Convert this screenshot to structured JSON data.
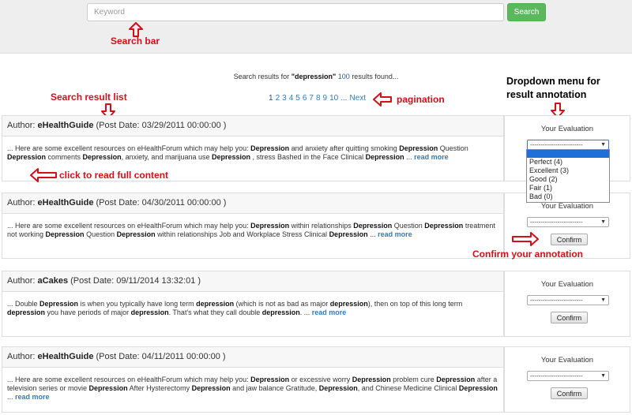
{
  "search": {
    "placeholder": "Keyword",
    "button_label": "Search"
  },
  "annotations": {
    "search_bar": "Search bar",
    "result_list": "Search result list",
    "pagination": "pagination",
    "dropdown_line1": "Dropdown menu for",
    "dropdown_line2": "result annotation",
    "read_full": "click to read full content",
    "confirm_annotation": "Confirm your annotation"
  },
  "summary": {
    "prefix": "Search results for",
    "query": "\"depression\"",
    "count": "100",
    "suffix": "results found..."
  },
  "pagination": {
    "pages": [
      "1",
      "2",
      "3",
      "4",
      "5",
      "6",
      "7",
      "8",
      "9",
      "10"
    ],
    "ellipsis": "...",
    "next": "Next"
  },
  "evaluation": {
    "title": "Your Evaluation",
    "placeholder": "-------------------------",
    "confirm_label": "Confirm",
    "options": [
      "Perfect (4)",
      "Excellent (3)",
      "Good (2)",
      "Fair (1)",
      "Bad (0)"
    ]
  },
  "results": [
    {
      "author_label": "Author:",
      "author": "eHealthGuide",
      "post_date": "(Post Date: 03/29/2011 00:00:00 )",
      "body_html": "... Here are some excellent resources on eHealthForum which may help you: <b>Depression</b> and anxiety after quitting smoking <b>Depression</b> Question <b>Depression</b> comments <b>Depression</b>, anxiety, and marijuana use <b>Depression</b> , stress Bashed in the Face Clinical <b>Depression</b> ... <a data-name='read-more-link' data-interactable='true'>read more</a>"
    },
    {
      "author_label": "Author:",
      "author": "eHealthGuide",
      "post_date": "(Post Date: 04/30/2011 00:00:00 )",
      "body_html": "... Here are some excellent resources on eHealthForum which may help you: <b>Depression</b> within relationships <b>Depression</b> Question <b>Depression</b> treatment not working <b>Depression</b> Question <b>Depression</b> within relationships Job and Workplace Stress Clinical <b>Depression</b> ... <a data-name='read-more-link' data-interactable='true'>read more</a>"
    },
    {
      "author_label": "Author:",
      "author": "aCakes",
      "post_date": "(Post Date: 09/11/2014 13:32:01 )",
      "body_html": "... Double <b>Depression</b> is when you typically have long term <b>depression</b> (which is not as bad as major <b>depression</b>), then on top of this long term <b>depression</b> you have periods of major <b>depression</b>. That's what they call double <b>depression</b>. ... <a data-name='read-more-link' data-interactable='true'>read more</a>"
    },
    {
      "author_label": "Author:",
      "author": "eHealthGuide",
      "post_date": "(Post Date: 04/11/2011 00:00:00 )",
      "body_html": "... Here are some excellent resources on eHealthForum which may help you: <b>Depression</b> or excessive worry <b>Depression</b> problem cure <b>Depression</b> after a television series or movie <b>Depression</b> After Hysterectomy <b>Depression</b> and jaw balance Gratitude, <b>Depression</b>, and Chinese Medicine Clinical <b>Depression</b> ... <a data-name='read-more-link' data-interactable='true'>read more</a>"
    }
  ]
}
